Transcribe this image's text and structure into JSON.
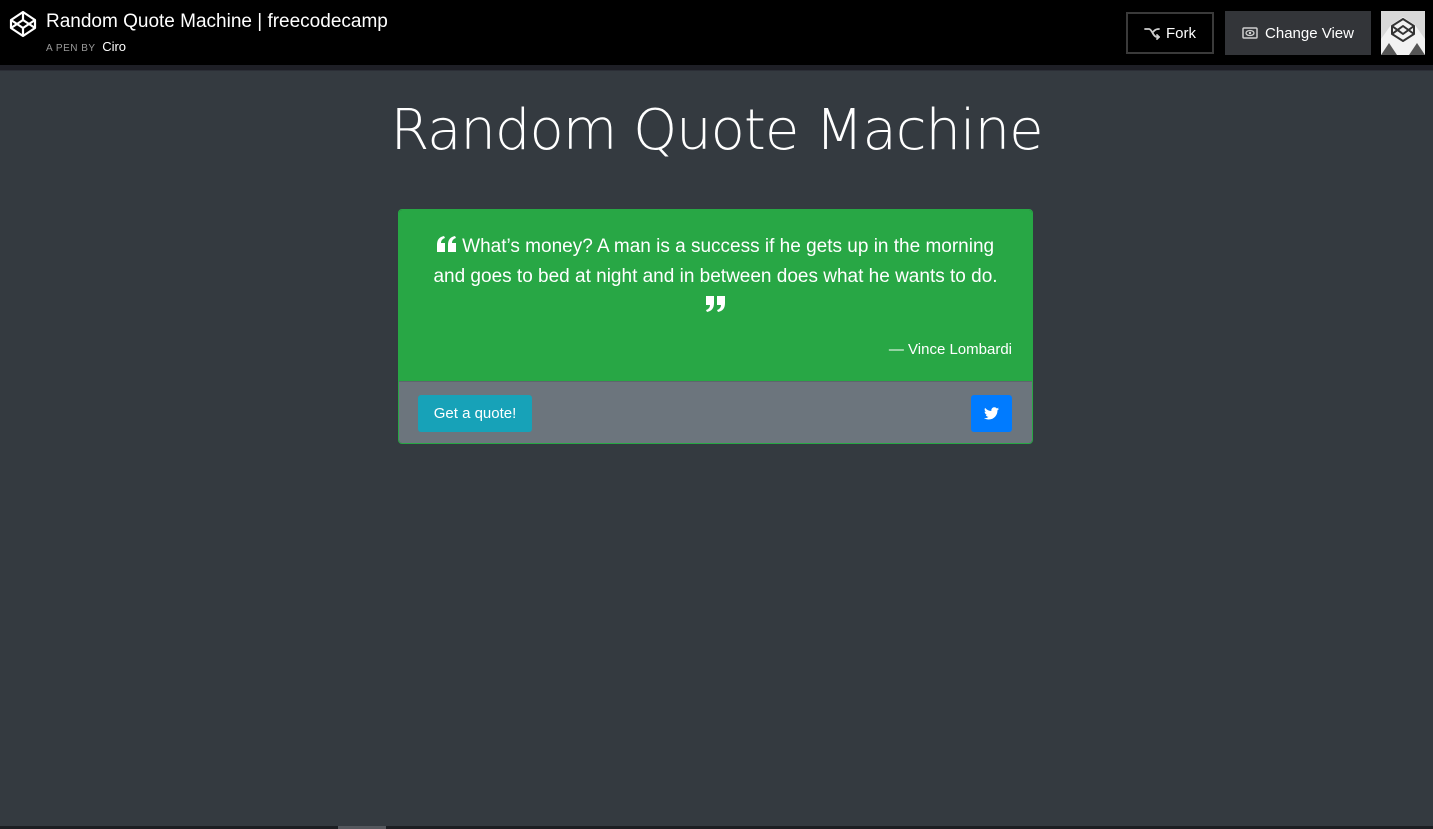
{
  "header": {
    "pen_title": "Random Quote Machine | freecodecamp",
    "byline_prefix": "A PEN BY",
    "author": "Ciro",
    "fork_label": "Fork",
    "change_view_label": "Change View",
    "icons": {
      "logo": "codepen-logo-icon",
      "fork": "fork-icon",
      "change_view": "eye-icon",
      "avatar": "user-avatar"
    }
  },
  "main": {
    "title": "Random Quote Machine"
  },
  "quote": {
    "text": "What’s money? A man is a success if he gets up in the morning and goes to bed at night and in between does what he wants to do.",
    "author": "— Vince Lombardi",
    "get_quote_label": "Get a quote!",
    "tweet_icon": "twitter-icon"
  },
  "colors": {
    "page_background": "#343a40",
    "header_background": "#000000",
    "quote_background": "#28a745",
    "footer_background": "#6c757d",
    "get_quote_button": "#17a2b8",
    "tweet_button": "#007bff"
  }
}
